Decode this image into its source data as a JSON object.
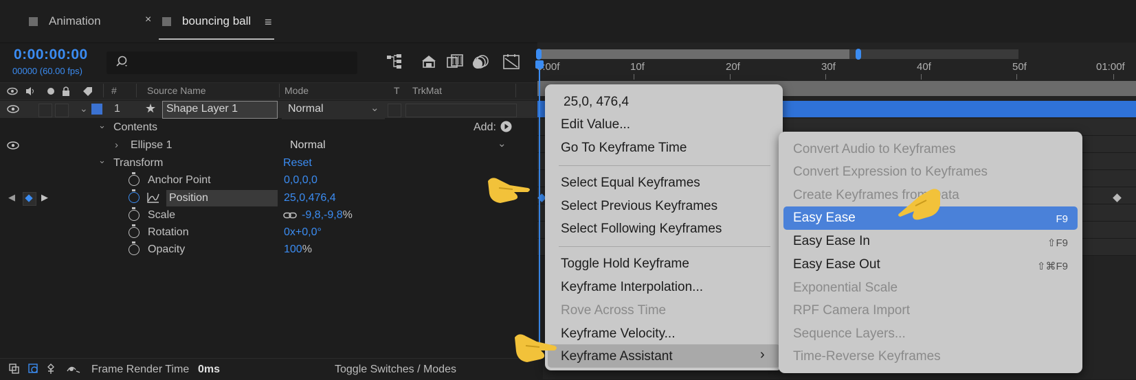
{
  "tabs": [
    {
      "label": "Animation"
    },
    {
      "label": "bouncing ball"
    }
  ],
  "tab_close": "×",
  "tab_menu": "≡",
  "timecode": "0:00:00:00",
  "frame_info": "00000 (60.00 fps)",
  "search": {
    "placeholder": ""
  },
  "columns": {
    "num": "#",
    "source_name": "Source Name",
    "mode": "Mode",
    "t": "T",
    "trkmat": "TrkMat"
  },
  "layer": {
    "index": "1",
    "name": "Shape Layer 1",
    "mode": "Normal"
  },
  "contents": {
    "label": "Contents",
    "add_label": "Add:",
    "ellipse_label": "Ellipse 1",
    "ellipse_mode": "Normal"
  },
  "transform": {
    "label": "Transform",
    "reset": "Reset",
    "properties": [
      {
        "name": "Anchor Point",
        "value": "0,0,0,0"
      },
      {
        "name": "Position",
        "value": "25,0,476,4"
      },
      {
        "name": "Scale",
        "value": "-9,8,-9,8",
        "suffix": "%"
      },
      {
        "name": "Rotation",
        "value": "0x+0,0°"
      },
      {
        "name": "Opacity",
        "value": "100",
        "suffix": "%"
      }
    ]
  },
  "ruler": [
    "0:00f",
    "10f",
    "20f",
    "30f",
    "40f",
    "50f",
    "01:00f"
  ],
  "bottom": {
    "frame_render_label": "Frame Render Time",
    "frame_render_value": "0ms",
    "toggle": "Toggle Switches / Modes"
  },
  "context_menu": {
    "items": [
      {
        "label": "25,0, 476,4"
      },
      {
        "label": "Edit Value..."
      },
      {
        "label": "Go To Keyframe Time"
      },
      {
        "label": "Select Equal Keyframes"
      },
      {
        "label": "Select Previous Keyframes"
      },
      {
        "label": "Select Following Keyframes"
      },
      {
        "label": "Toggle Hold Keyframe"
      },
      {
        "label": "Keyframe Interpolation..."
      },
      {
        "label": "Rove Across Time"
      },
      {
        "label": "Keyframe Velocity..."
      },
      {
        "label": "Keyframe Assistant"
      }
    ]
  },
  "submenu": {
    "items": [
      {
        "label": "Convert Audio to Keyframes"
      },
      {
        "label": "Convert Expression to Keyframes"
      },
      {
        "label": "Create Keyframes from Data"
      },
      {
        "label": "Easy Ease",
        "shortcut": "F9"
      },
      {
        "label": "Easy Ease In",
        "shortcut": "⇧F9"
      },
      {
        "label": "Easy Ease Out",
        "shortcut": "⇧⌘F9"
      },
      {
        "label": "Exponential Scale"
      },
      {
        "label": "RPF Camera Import"
      },
      {
        "label": "Sequence Layers..."
      },
      {
        "label": "Time-Reverse Keyframes"
      }
    ]
  },
  "colors": {
    "accent": "#3b8cf2",
    "highlight": "#4a81d9",
    "pointer": "#f2c23a"
  }
}
